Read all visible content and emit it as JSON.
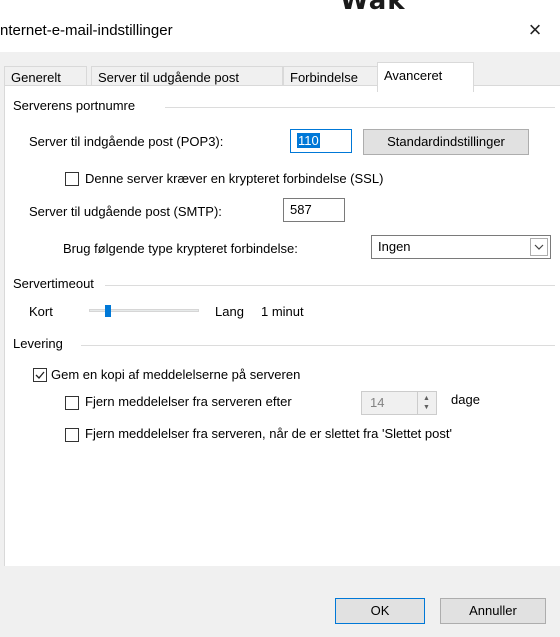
{
  "window": {
    "title": "nternet-e-mail-indstillinger",
    "top_logo": "Wak",
    "close_label": "×"
  },
  "tabs": [
    {
      "label": "Generelt",
      "active": false
    },
    {
      "label": "Server til udgående post",
      "active": false
    },
    {
      "label": "Forbindelse",
      "active": false
    },
    {
      "label": "Avanceret",
      "active": true
    }
  ],
  "ports": {
    "group_label": "Serverens portnumre",
    "incoming_label": "Server til indgående post (POP3):",
    "incoming_value": "110",
    "defaults_button": "Standardindstillinger",
    "ssl_checkbox_label": "Denne server kræver en krypteret forbindelse (SSL)",
    "ssl_checked": false,
    "outgoing_label": "Server til udgående post (SMTP):",
    "outgoing_value": "587",
    "encryption_label": "Brug følgende type krypteret forbindelse:",
    "encryption_value": "Ingen"
  },
  "timeout": {
    "group_label": "Servertimeout",
    "short_label": "Kort",
    "long_label": "Lang",
    "value_label": "1 minut",
    "slider_level": 0.15
  },
  "delivery": {
    "group_label": "Levering",
    "keep_copy_label": "Gem en kopi af meddelelserne på serveren",
    "keep_copy_checked": true,
    "remove_after_label": "Fjern meddelelser fra serveren efter",
    "remove_after_checked": false,
    "days_value": "14",
    "days_unit": "dage",
    "remove_deleted_label": "Fjern meddelelser fra serveren, når de er slettet fra 'Slettet post'",
    "remove_deleted_checked": false
  },
  "footer": {
    "ok_label": "OK",
    "cancel_label": "Annuller"
  }
}
